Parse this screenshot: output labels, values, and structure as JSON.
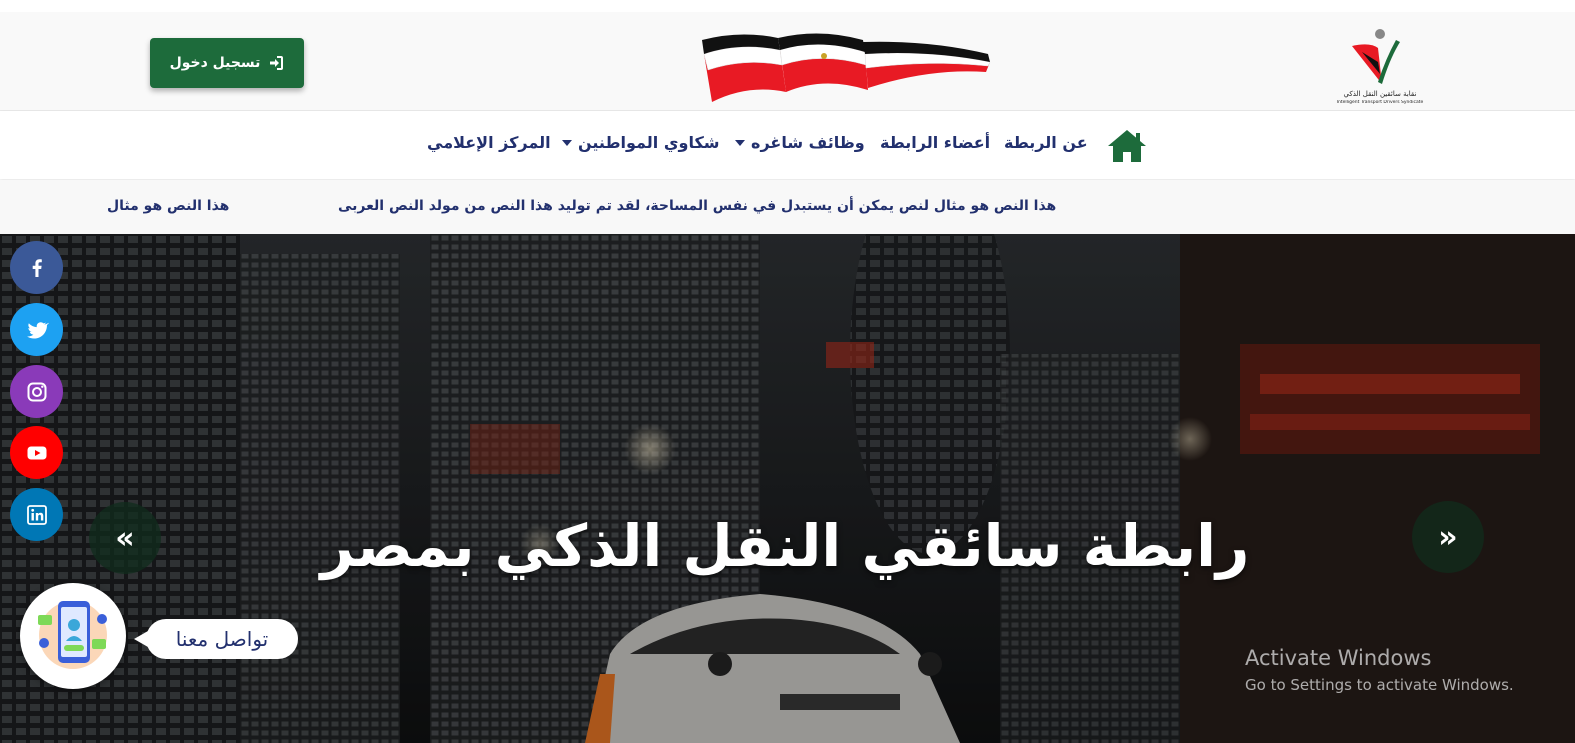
{
  "header": {
    "login_label": "تسجيل دخول",
    "org_logo_caption_ar": "نقابة سائقين النقل الذكي",
    "org_logo_caption_en": "Intelligent Transport Drivers Syndicate"
  },
  "nav": {
    "items": [
      {
        "label": "عن الربطة",
        "icon": "home-icon"
      },
      {
        "label": "أعضاء الرابطة"
      },
      {
        "label": "وظائف شاغره",
        "has_dropdown": true
      },
      {
        "label": "شكاوي المواطنين",
        "has_dropdown": true
      },
      {
        "label": "المركز الإعلامي"
      }
    ]
  },
  "ticker": {
    "items": [
      "هذا النص هو مثال لنص يمكن أن يستبدل في نفس المساحة، لقد تم توليد هذا النص من مولد النص العربى",
      "هذا النص هو مثال"
    ]
  },
  "hero": {
    "title": "رابطة سائقي النقل الذكي بمصر",
    "prev_arrow": "«",
    "next_arrow": "»"
  },
  "social": [
    "facebook-icon",
    "twitter-icon",
    "instagram-icon",
    "youtube-icon",
    "linkedin-icon"
  ],
  "contact": {
    "label": "تواصل معنا"
  },
  "watermark": {
    "line1": "Activate Windows",
    "line2": "Go to Settings to activate Windows."
  },
  "colors": {
    "primary_green": "#1d6b3b",
    "nav_text": "#22306e",
    "facebook": "#3b5998",
    "twitter": "#1da1f2",
    "instagram": "#8a3ab9",
    "youtube": "#ff0000",
    "linkedin": "#0077b5"
  }
}
